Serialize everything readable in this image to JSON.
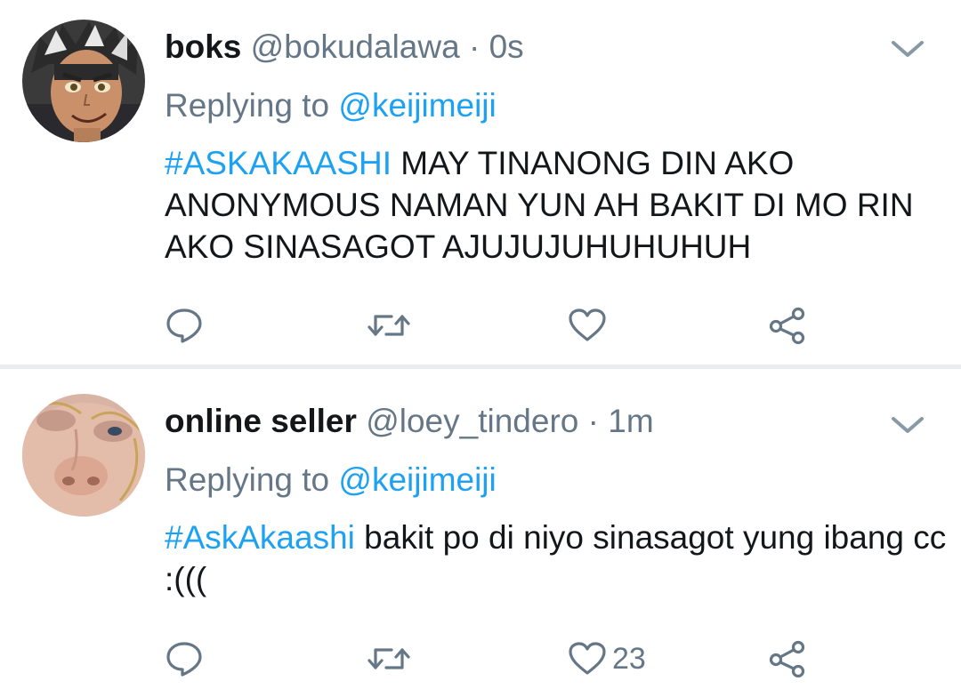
{
  "tweets": [
    {
      "display_name": "boks",
      "handle": "@bokudalawa",
      "separator": "·",
      "time": "0s",
      "replying_label": "Replying to",
      "replying_to": "@keijimeiji",
      "hashtag": "#ASKAKAASHI",
      "text": " MAY TINANONG DIN AKO ANONYMOUS NAMAN YUN AH BAKIT DI MO RIN AKO SINASAGOT AJUJUJUHUHUHUH",
      "like_count": "",
      "avatar_icon": "anime-character-avatar"
    },
    {
      "display_name": "online seller",
      "handle": "@loey_tindero",
      "separator": "·",
      "time": "1m",
      "replying_label": "Replying to",
      "replying_to": "@keijimeiji",
      "hashtag": "#AskAkaashi",
      "text": " bakit po di niyo sinasagot yung ibang cc :(((",
      "like_count": "23",
      "avatar_icon": "closeup-face-avatar"
    }
  ],
  "icons": {
    "reply": "reply-icon",
    "retweet": "retweet-icon",
    "like": "heart-icon",
    "share": "share-icon",
    "menu": "chevron-down-icon"
  },
  "colors": {
    "link_blue": "#1da1f2",
    "secondary_text": "#657786",
    "primary_text": "#14171a",
    "divider": "#e9edf0",
    "icon_gray": "#657786"
  }
}
